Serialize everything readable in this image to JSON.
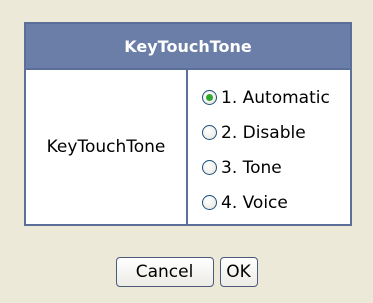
{
  "header": {
    "title": "KeyTouchTone"
  },
  "row": {
    "label": "KeyTouchTone"
  },
  "options": [
    {
      "label": "1. Automatic",
      "selected": true
    },
    {
      "label": "2. Disable",
      "selected": false
    },
    {
      "label": "3. Tone",
      "selected": false
    },
    {
      "label": "4. Voice",
      "selected": false
    }
  ],
  "buttons": {
    "cancel_label": "Cancel",
    "ok_label": "OK"
  },
  "colors": {
    "header_bg": "#6a7ea8",
    "border": "#5c6e9a",
    "page_bg": "#ece9d8",
    "radio_selected": "#2fa82f"
  }
}
